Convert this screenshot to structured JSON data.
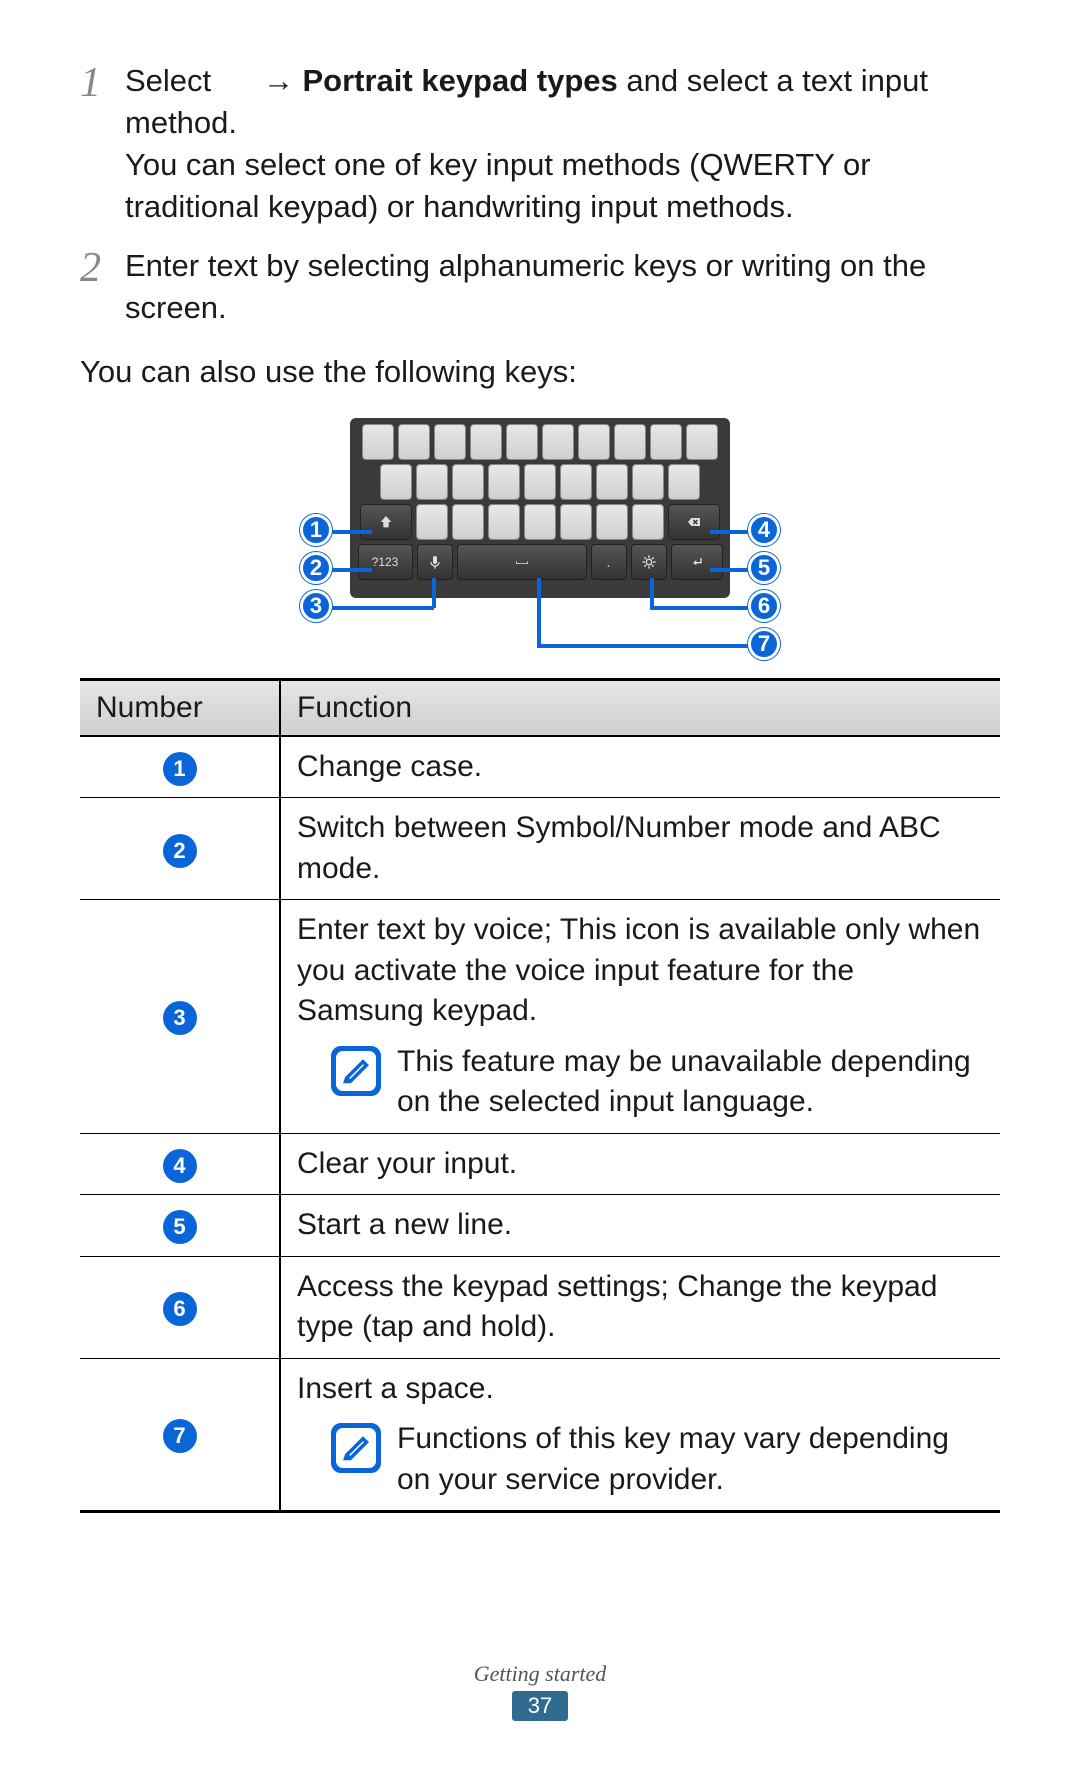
{
  "steps": [
    {
      "num": "1",
      "prefix": "Select ",
      "arrow": "→ ",
      "bold": "Portrait keypad types",
      "suffix": " and select a text input method.",
      "detail": "You can select one of key input methods (QWERTY or traditional keypad) or handwriting input methods."
    },
    {
      "num": "2",
      "text": "Enter text by selecting alphanumeric keys or writing on the screen."
    }
  ],
  "intro": "You can also use the following keys:",
  "keyboard": {
    "sym_label": "?123",
    "period": "."
  },
  "callouts": [
    "1",
    "2",
    "3",
    "4",
    "5",
    "6",
    "7"
  ],
  "table": {
    "headers": {
      "num": "Number",
      "func": "Function"
    },
    "rows": [
      {
        "n": "1",
        "text": "Change case."
      },
      {
        "n": "2",
        "text": "Switch between Symbol/Number mode and ABC mode."
      },
      {
        "n": "3",
        "text": "Enter text by voice; This icon is available only when you activate the voice input feature for the Samsung keypad.",
        "note": "This feature may be unavailable depending on the selected input language."
      },
      {
        "n": "4",
        "text": "Clear your input."
      },
      {
        "n": "5",
        "text": "Start a new line."
      },
      {
        "n": "6",
        "text": "Access the keypad settings; Change the keypad type (tap and hold)."
      },
      {
        "n": "7",
        "text": "Insert a space.",
        "note": "Functions of this key may vary depending on your service provider."
      }
    ]
  },
  "footer": {
    "section": "Getting started",
    "page": "37"
  }
}
